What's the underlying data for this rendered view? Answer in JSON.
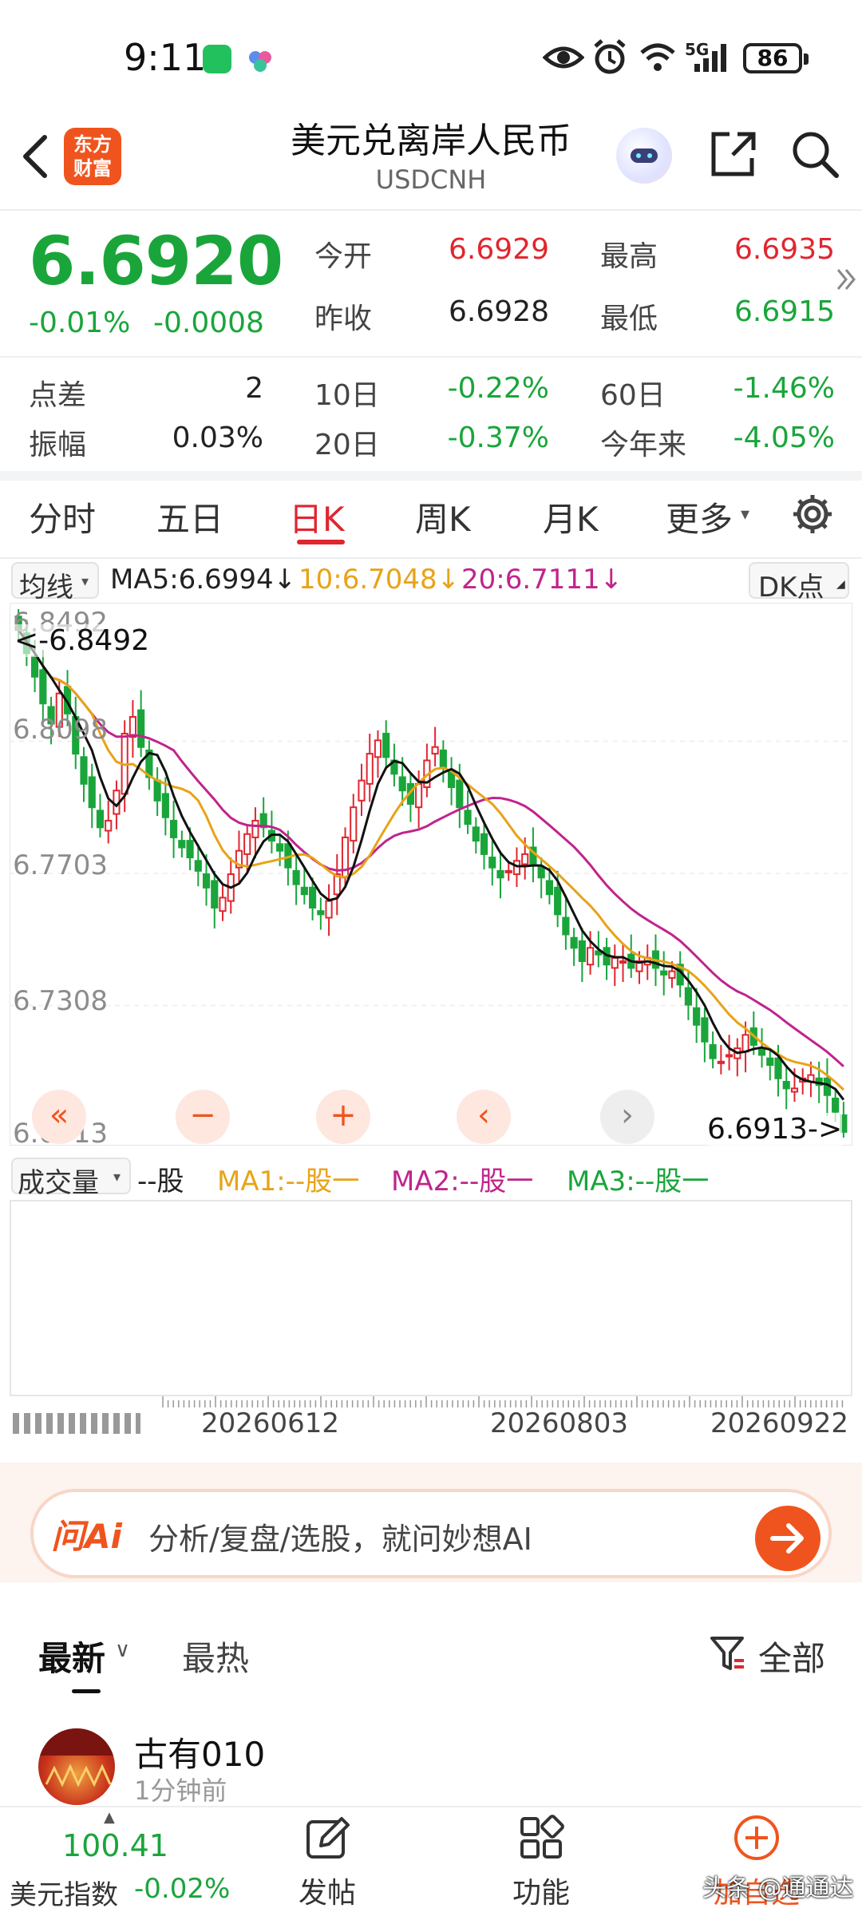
{
  "status_bar": {
    "time": "9:11",
    "battery": "86",
    "network": "5G"
  },
  "header": {
    "title": "美元兑离岸人民币",
    "subtitle": "USDCNH",
    "logo_text": "东方\n财富"
  },
  "quote": {
    "price": "6.6920",
    "change_pct": "-0.01%",
    "change_abs": "-0.0008",
    "open_label": "今开",
    "open": "6.6929",
    "high_label": "最高",
    "high": "6.6935",
    "prev_label": "昨收",
    "prev_close": "6.6928",
    "low_label": "最低",
    "low": "6.6915",
    "spread_label": "点差",
    "spread": "2",
    "d10_label": "10日",
    "d10": "-0.22%",
    "d60_label": "60日",
    "d60": "-1.46%",
    "amp_label": "振幅",
    "amplitude": "0.03%",
    "d20_label": "20日",
    "d20": "-0.37%",
    "ytd_label": "今年来",
    "ytd": "-4.05%"
  },
  "tabs": [
    "分时",
    "五日",
    "日K",
    "周K",
    "月K",
    "更多"
  ],
  "active_tab": "日K",
  "indicators": {
    "selector": "均线",
    "ma5": "MA5:6.6994↓",
    "ma10": "10:6.7048↓",
    "ma20": "20:6.7111↓",
    "dk": "DK点"
  },
  "chart_data": {
    "type": "candlestick",
    "y_ticks": [
      "6.8492",
      "6.8098",
      "6.7703",
      "6.7308",
      "6.6913"
    ],
    "ylim": [
      6.6913,
      6.8492
    ],
    "max_marker": "<-6.8492",
    "min_marker": "6.6913->",
    "x_ticks": [
      "20260612",
      "20260803",
      "20260922"
    ],
    "ma_colors": {
      "ma5": "#111111",
      "ma10": "#e8a317",
      "ma20": "#c0248c"
    },
    "up_color": "#e0262f",
    "down_color": "#1aa53b",
    "closes": [
      6.843,
      6.836,
      6.829,
      6.821,
      6.815,
      6.824,
      6.818,
      6.806,
      6.797,
      6.79,
      6.784,
      6.786,
      6.795,
      6.812,
      6.817,
      6.808,
      6.799,
      6.792,
      6.787,
      6.781,
      6.778,
      6.775,
      6.771,
      6.766,
      6.76,
      6.763,
      6.77,
      6.777,
      6.782,
      6.786,
      6.784,
      6.78,
      6.777,
      6.772,
      6.767,
      6.764,
      6.76,
      6.758,
      6.762,
      6.77,
      6.781,
      6.79,
      6.798,
      6.806,
      6.81,
      6.805,
      6.8,
      6.795,
      6.791,
      6.797,
      6.804,
      6.808,
      6.802,
      6.796,
      6.79,
      6.785,
      6.78,
      6.776,
      6.772,
      6.769,
      6.771,
      6.774,
      6.776,
      6.773,
      6.769,
      6.764,
      6.758,
      6.752,
      6.748,
      6.744,
      6.748,
      6.746,
      6.743,
      6.745,
      6.744,
      6.742,
      6.744,
      6.745,
      6.742,
      6.74,
      6.741,
      6.737,
      6.731,
      6.725,
      6.72,
      6.715,
      6.714,
      6.716,
      6.718,
      6.722,
      6.719,
      6.716,
      6.713,
      6.709,
      6.706,
      6.706,
      6.709,
      6.71,
      6.707,
      6.704,
      6.699,
      6.693
    ]
  },
  "volume": {
    "selector": "成交量",
    "unit": "--股",
    "ma1": "MA1:--股一",
    "ma2": "MA2:--股一",
    "ma3": "MA3:--股一"
  },
  "ai": {
    "logo": "问Ai",
    "placeholder": "分析/复盘/选股，就问妙想AI"
  },
  "feed": {
    "tab_latest": "最新",
    "tab_hot": "最热",
    "filter": "全部",
    "post_author": "古有010",
    "post_time": "1分钟前"
  },
  "bottom_nav": {
    "index_value": "100.41",
    "index_name": "美元指数",
    "index_change": "-0.02%",
    "post": "发帖",
    "function": "功能",
    "watch": "加自选",
    "watermark": "头条 @通通达"
  }
}
